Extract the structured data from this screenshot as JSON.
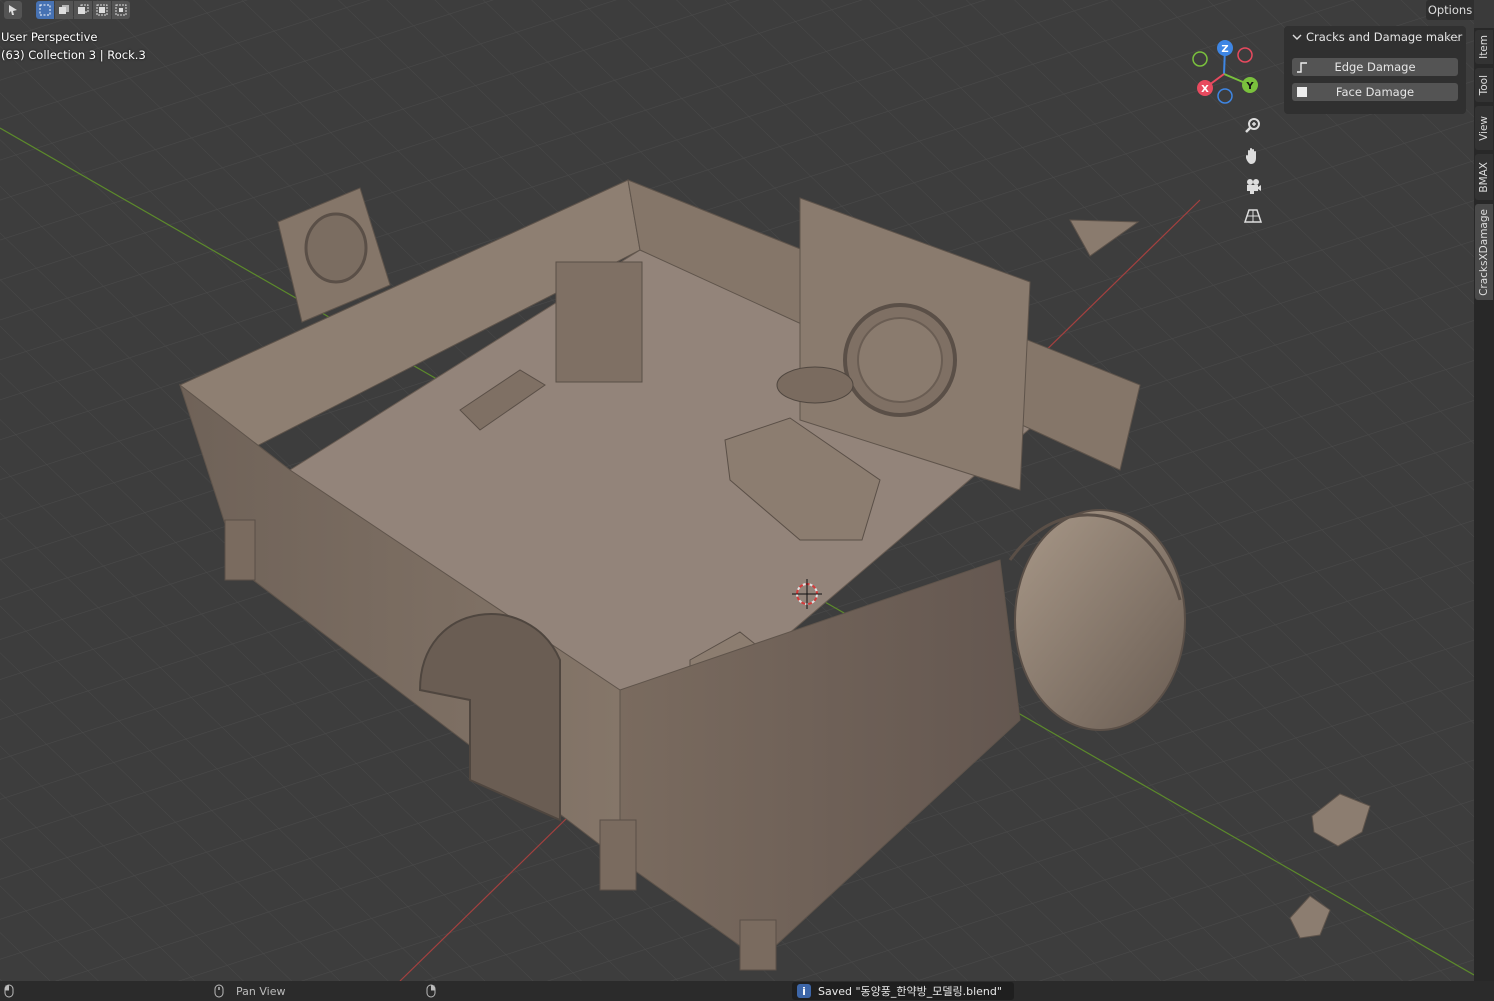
{
  "viewport": {
    "view_name": "User Perspective",
    "collection_info": "(63) Collection 3 | Rock.3"
  },
  "header": {
    "options_label": "Options"
  },
  "panel": {
    "title": "Cracks and Damage maker",
    "buttons": [
      {
        "label": "Edge Damage"
      },
      {
        "label": "Face Damage"
      }
    ]
  },
  "gizmo": {
    "x_label": "X",
    "y_label": "Y",
    "z_label": "Z",
    "x_color": "#e84a5f",
    "y_color": "#7ac13d",
    "z_color": "#3e86e4"
  },
  "sidebar": {
    "tabs": [
      {
        "label": "Item"
      },
      {
        "label": "Tool"
      },
      {
        "label": "View"
      },
      {
        "label": "BMAX"
      },
      {
        "label": "CracksXDamage"
      }
    ]
  },
  "statusbar": {
    "pan_view_label": "Pan View",
    "message": "Saved \"동양풍_한약방_모델링.blend\""
  },
  "colors": {
    "viewport_bg": "#3d3d3d",
    "model_color": "#8c7d70",
    "accent": "#4772b3"
  }
}
